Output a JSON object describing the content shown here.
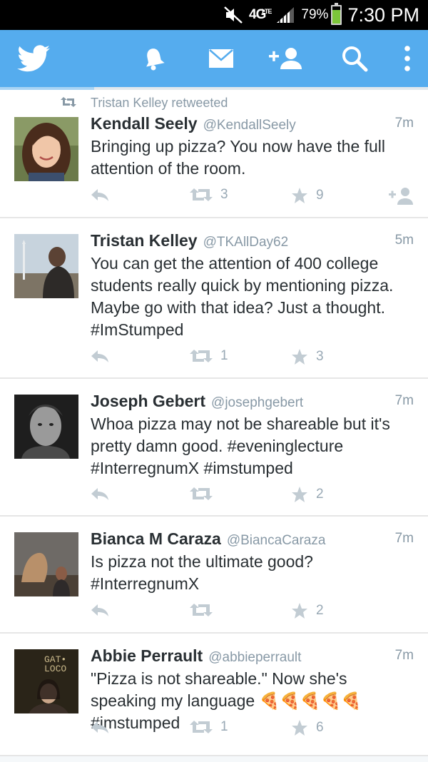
{
  "status_bar": {
    "network": "4G",
    "network_sub": "LTE",
    "battery_percent": "79%",
    "battery_level": 0.79,
    "time": "7:30 PM",
    "icons": [
      "mute-icon",
      "signal-icon",
      "battery-icon"
    ]
  },
  "app_bar": {
    "color": "#55acee",
    "icons": [
      "twitter-logo-icon",
      "notifications-bell-icon",
      "messages-envelope-icon",
      "add-user-icon",
      "search-icon",
      "overflow-menu-icon"
    ]
  },
  "tweets": [
    {
      "retweeted_by": "Tristan Kelley retweeted",
      "name": "Kendall Seely",
      "handle": "@KendallSeely",
      "time": "7m",
      "text": "Bringing up pizza? You now have the full attention of the room.",
      "retweets": "3",
      "favorites": "9",
      "follow_icon": true
    },
    {
      "name": "Tristan Kelley",
      "handle": "@TKAllDay62",
      "time": "5m",
      "text": "You can get the attention of 400 college students really quick by mentioning pizza. Maybe go with that idea? Just a thought. #ImStumped",
      "retweets": "1",
      "favorites": "3"
    },
    {
      "name": "Joseph Gebert",
      "handle": "@josephgebert",
      "time": "7m",
      "text": "Whoa pizza may not be shareable but it's pretty damn good. #eveninglecture #InterregnumX #imstumped",
      "retweets": "",
      "favorites": "2"
    },
    {
      "name": "Bianca M Caraza",
      "handle": "@BiancaCaraza",
      "time": "7m",
      "text": "Is pizza not the ultimate good? #InterregnumX",
      "retweets": "",
      "favorites": "2"
    },
    {
      "name": "Abbie Perrault",
      "handle": "@abbieperrault",
      "time": "7m",
      "text": "\"Pizza is not shareable.\" Now she's speaking my language 🍕🍕🍕🍕🍕 #imstumped",
      "retweets": "1",
      "favorites": "6",
      "avatar_text": "GAT• LOCO"
    }
  ]
}
